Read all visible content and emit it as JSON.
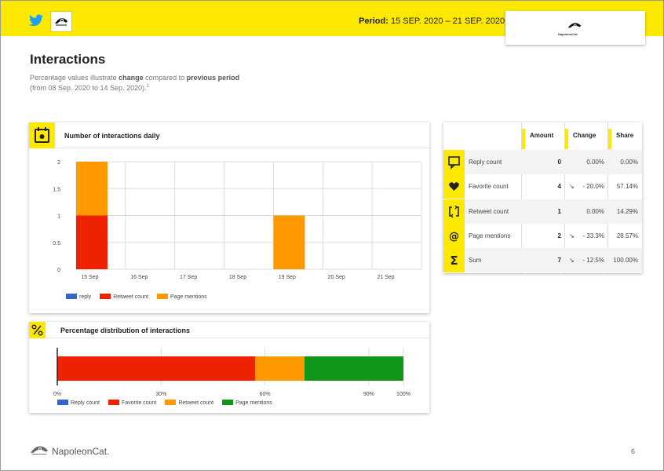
{
  "header": {
    "period_label": "Period:",
    "period_value": "15 SEP. 2020 – 21 SEP. 2020",
    "logo_small_text": "NapoleonCat"
  },
  "title": "Interactions",
  "subtitle": {
    "p1": "Percentage values illustrate ",
    "b1": "change",
    "p2": " compared to ",
    "b2": "previous period",
    "line2": "(from 08 Sep. 2020 to 14 Sep. 2020).",
    "sup": "1"
  },
  "daily_card": {
    "title": "Number of interactions daily"
  },
  "dist_card": {
    "title": "Percentage distribution of interactions"
  },
  "table": {
    "headers": [
      "Amount",
      "Change",
      "Share"
    ],
    "rows": [
      {
        "label": "Reply count",
        "amount": "0",
        "arrow": "",
        "change": "0.00%",
        "share": "0.00%",
        "icon": "comment-icon"
      },
      {
        "label": "Favorite count",
        "amount": "4",
        "arrow": "↘",
        "change": "- 20.0%",
        "share": "57.14%",
        "icon": "heart-icon"
      },
      {
        "label": "Retweet count",
        "amount": "1",
        "arrow": "",
        "change": "0.00%",
        "share": "14.29%",
        "icon": "retweet-icon"
      },
      {
        "label": "Page mentions",
        "amount": "2",
        "arrow": "↘",
        "change": "- 33.3%",
        "share": "28.57%",
        "icon": "at-icon"
      },
      {
        "label": "Sum",
        "amount": "7",
        "arrow": "↘",
        "change": "- 12.5%",
        "share": "100.00%",
        "icon": "sigma-icon"
      }
    ]
  },
  "footer": {
    "brand": "NapoleonCat.",
    "page": "6"
  },
  "colors": {
    "accent": "#fde900",
    "reply": "#3366cc",
    "favorite": "#ee2200",
    "retweet": "#ff9900",
    "mentions": "#109618"
  },
  "chart_data": [
    {
      "type": "bar",
      "stacked": true,
      "categories": [
        "15 Sep",
        "16 Sep",
        "17 Sep",
        "18 Sep",
        "19 Sep",
        "20 Sep",
        "21 Sep"
      ],
      "series": [
        {
          "name": "reply",
          "color": "#3366cc",
          "values": [
            0,
            0,
            0,
            0,
            0,
            0,
            0
          ]
        },
        {
          "name": "Retweet count",
          "color": "#ee2200",
          "values": [
            1,
            0,
            0,
            0,
            0,
            0,
            0
          ]
        },
        {
          "name": "Page mentions",
          "color": "#ff9900",
          "values": [
            1,
            0,
            0,
            0,
            1,
            0,
            0
          ]
        }
      ],
      "yticks": [
        "0",
        "0.5",
        "1",
        "1.5",
        "2"
      ],
      "ylim": [
        0,
        2
      ],
      "legend": "bottom-left"
    },
    {
      "type": "bar",
      "orientation": "horizontal",
      "stacked": true,
      "series": [
        {
          "name": "Reply count",
          "color": "#3366cc",
          "value": 0
        },
        {
          "name": "Favorite count",
          "color": "#ee2200",
          "value": 57.14
        },
        {
          "name": "Retweet count",
          "color": "#ff9900",
          "value": 14.29
        },
        {
          "name": "Page mentions",
          "color": "#109618",
          "value": 28.57
        }
      ],
      "xticks": [
        "0%",
        "30%",
        "60%",
        "90%",
        "100%"
      ],
      "tick_values": [
        0,
        30,
        60,
        90,
        100
      ],
      "xlim": [
        0,
        100
      ],
      "legend": "bottom-left"
    }
  ]
}
